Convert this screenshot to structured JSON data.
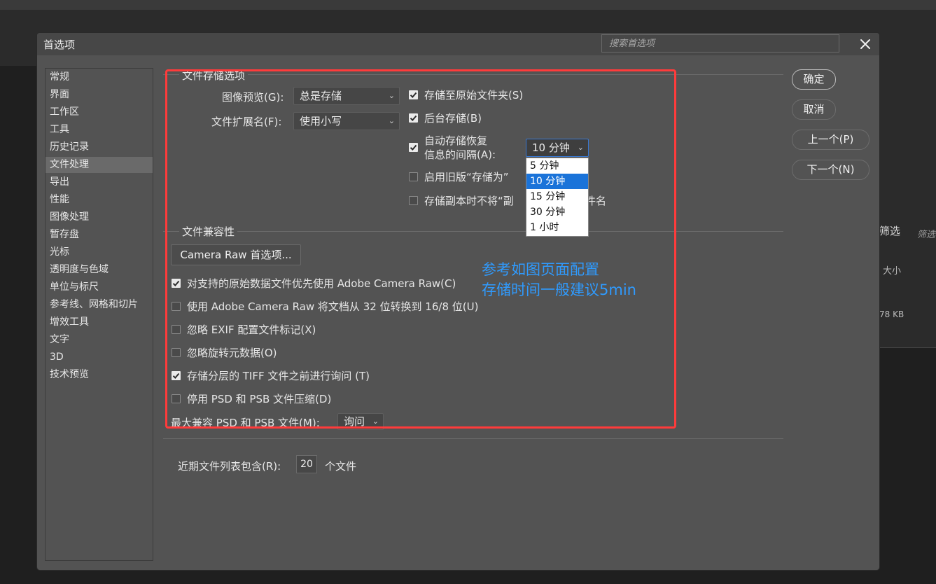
{
  "background": {
    "right_panel": {
      "filter_label": "筛选",
      "filter_input_placeholder": "筛选",
      "size_header": "大小",
      "file_size": "78 KB"
    }
  },
  "dialog": {
    "title": "首选项",
    "search_placeholder": "搜索首选项",
    "buttons": {
      "ok": "确定",
      "cancel": "取消",
      "prev": "上一个(P)",
      "next": "下一个(N)"
    }
  },
  "sidebar": {
    "items": [
      "常规",
      "界面",
      "工作区",
      "工具",
      "历史记录",
      "文件处理",
      "导出",
      "性能",
      "图像处理",
      "暂存盘",
      "光标",
      "透明度与色域",
      "单位与标尺",
      "参考线、网格和切片",
      "增效工具",
      "文字",
      "3D",
      "技术预览"
    ],
    "active_index": 5
  },
  "file_save": {
    "group_title": "文件存储选项",
    "image_preview_label": "图像预览(G):",
    "image_preview_value": "总是存储",
    "extension_label": "文件扩展名(F):",
    "extension_value": "使用小写",
    "save_to_original": {
      "label": "存储至原始文件夹(S)",
      "checked": true
    },
    "background_save": {
      "label": "后台存储(B)",
      "checked": true
    },
    "auto_recover": {
      "label_line1": "自动存储恢复",
      "label_line2": "信息的间隔(A):",
      "checked": true,
      "value": "10 分钟"
    },
    "legacy_save_as": {
      "label": "启用旧版“存储为”",
      "checked": false
    },
    "copy_no_suffix": {
      "label": "存储副本时不将“副本”添加到文件名",
      "visible_prefix": "存储副本时不将“副",
      "visible_suffix": "件名",
      "checked": false
    },
    "interval_options": [
      "5 分钟",
      "10 分钟",
      "15 分钟",
      "30 分钟",
      "1 小时"
    ],
    "interval_selected_index": 1
  },
  "compat": {
    "group_title": "文件兼容性",
    "camera_raw_button": "Camera Raw 首选项...",
    "options": [
      {
        "label": "对支持的原始数据文件优先使用 Adobe Camera Raw(C)",
        "checked": true
      },
      {
        "label": "使用 Adobe Camera Raw 将文档从 32 位转换到 16/8 位(U)",
        "checked": false
      },
      {
        "label": "忽略 EXIF 配置文件标记(X)",
        "checked": false
      },
      {
        "label": "忽略旋转元数据(O)",
        "checked": false
      },
      {
        "label": "存储分层的 TIFF 文件之前进行询问 (T)",
        "checked": true
      },
      {
        "label": "停用 PSD 和 PSB 文件压缩(D)",
        "checked": false
      }
    ],
    "max_compat_label": "最大兼容 PSD 和 PSB 文件(M):",
    "max_compat_value": "询问"
  },
  "recent": {
    "label": "近期文件列表包含(R):",
    "value": "20",
    "suffix": "个文件"
  },
  "annotation": {
    "line1": "参考如图页面配置",
    "line2": "存储时间一般建议5min",
    "color": "#2f9bff",
    "box_color": "#ff3b3b"
  }
}
